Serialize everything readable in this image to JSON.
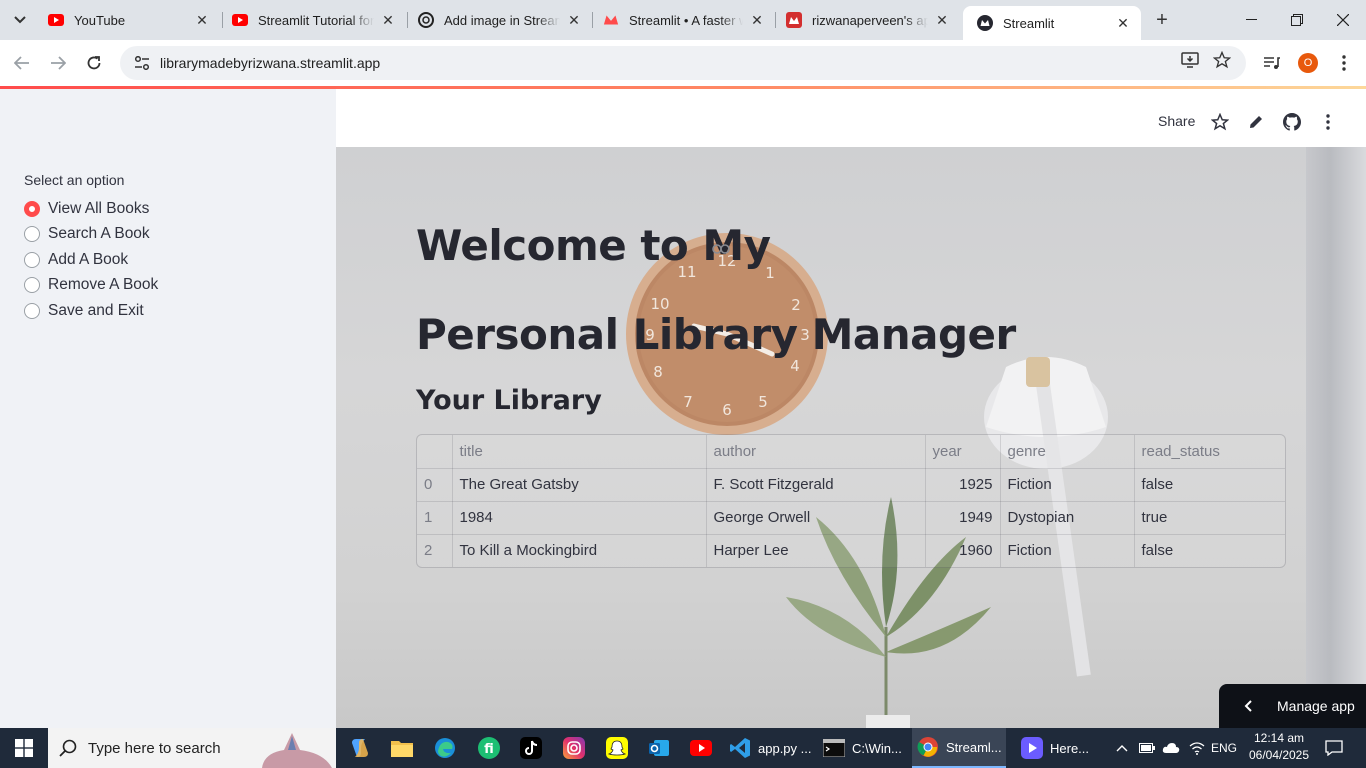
{
  "browser": {
    "tabs": [
      {
        "title": "YouTube",
        "favicon": "youtube-icon",
        "active": false
      },
      {
        "title": "Streamlit Tutorial for B",
        "favicon": "youtube-icon",
        "active": false
      },
      {
        "title": "Add image in Streamlit",
        "favicon": "chatgpt-icon",
        "active": false
      },
      {
        "title": "Streamlit • A faster way",
        "favicon": "streamlit-crown-icon",
        "active": false
      },
      {
        "title": "rizwanaperveen's app",
        "favicon": "streamlit-crown-icon",
        "active": false
      },
      {
        "title": "Streamlit",
        "favicon": "streamlit-crown-icon",
        "active": true
      }
    ],
    "url": "librarymadebyrizwana.streamlit.app",
    "profile_initial": "O",
    "accent": "#ff4b4b"
  },
  "sidebar": {
    "radio_label": "Select an option",
    "options": [
      "View All Books",
      "Search A Book",
      "Add A Book",
      "Remove A Book",
      "Save and Exit"
    ],
    "selected_index": 0
  },
  "header": {
    "share_label": "Share"
  },
  "main": {
    "title_line1": "Welcome to My",
    "title_line2": "Personal Library Manager",
    "subheader": "Your Library",
    "table": {
      "columns": [
        "",
        "title",
        "author",
        "year",
        "genre",
        "read_status"
      ],
      "rows": [
        {
          "index": "0",
          "title": "The Great Gatsby",
          "author": "F. Scott Fitzgerald",
          "year": "1925",
          "genre": "Fiction",
          "read_status": "false"
        },
        {
          "index": "1",
          "title": "1984",
          "author": "George Orwell",
          "year": "1949",
          "genre": "Dystopian",
          "read_status": "true"
        },
        {
          "index": "2",
          "title": "To Kill a Mockingbird",
          "author": "Harper Lee",
          "year": "1960",
          "genre": "Fiction",
          "read_status": "false"
        }
      ]
    },
    "manage_app_label": "Manage app"
  },
  "taskbar": {
    "search_placeholder": "Type here to search",
    "apps": [
      {
        "label": "app.py ...",
        "icon": "vscode-icon"
      },
      {
        "label": "C:\\Win...",
        "icon": "terminal-icon"
      },
      {
        "label": "Streaml...",
        "icon": "chrome-icon"
      },
      {
        "label": "Here...",
        "icon": "video-icon"
      }
    ],
    "language": "ENG",
    "time": "12:14 am",
    "date": "06/04/2025"
  }
}
